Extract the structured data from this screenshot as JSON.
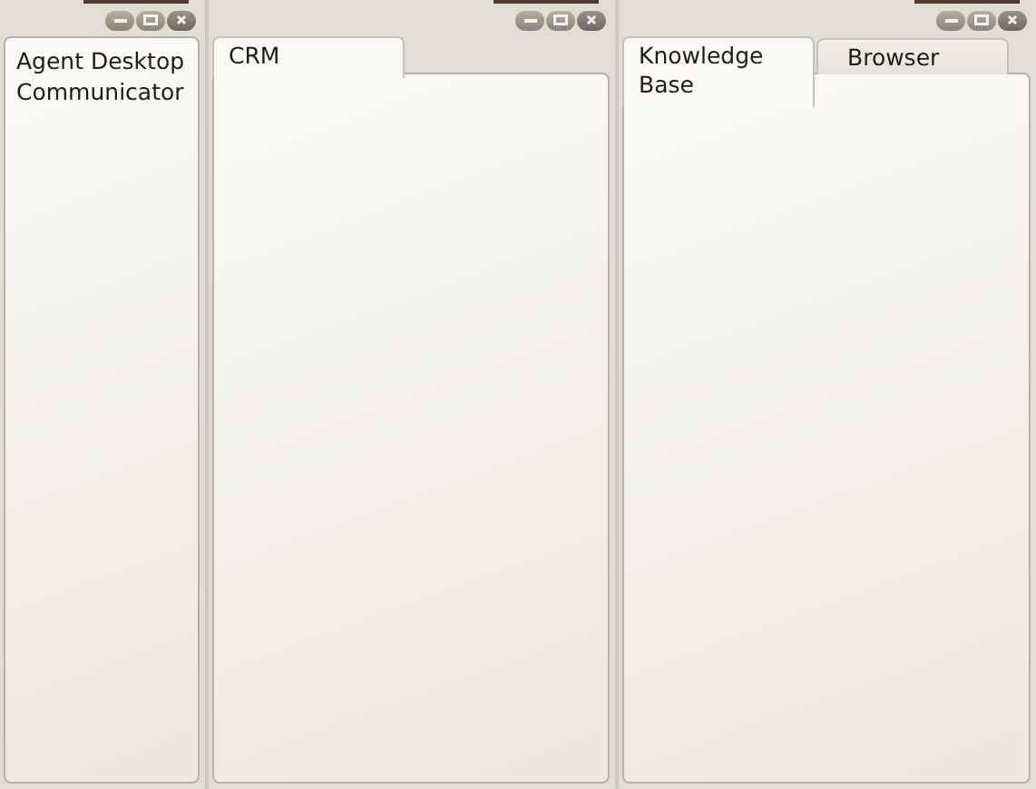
{
  "windows": [
    {
      "kind": "panel",
      "title": "Agent Desktop Communicator"
    },
    {
      "kind": "tabbed",
      "tabs": [
        {
          "label": "CRM",
          "selected": true
        }
      ]
    },
    {
      "kind": "tabbed",
      "tabs": [
        {
          "label": "Knowledge Base",
          "selected": true
        },
        {
          "label": "Browser",
          "selected": false
        }
      ]
    }
  ]
}
